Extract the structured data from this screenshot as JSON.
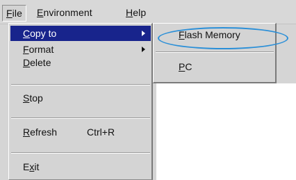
{
  "menubar": {
    "file": {
      "mnemonic": "F",
      "rest": "ile"
    },
    "environment": {
      "mnemonic": "E",
      "rest": "nvironment"
    },
    "help": {
      "mnemonic": "H",
      "rest": "elp"
    }
  },
  "file_menu": {
    "copy_to": {
      "mnemonic": "C",
      "rest": "opy to"
    },
    "format": {
      "mnemonic": "F",
      "rest": "ormat"
    },
    "delete": {
      "mnemonic": "D",
      "rest": "elete"
    },
    "stop": {
      "mnemonic": "S",
      "rest": "top"
    },
    "refresh": {
      "mnemonic": "R",
      "rest": "efresh",
      "shortcut": "Ctrl+R"
    },
    "exit": {
      "pre": "E",
      "mnemonic": "x",
      "rest": "it"
    }
  },
  "copy_to_submenu": {
    "flash_memory": {
      "mnemonic": "F",
      "rest": "lash Memory"
    },
    "pc": {
      "mnemonic": "P",
      "rest": "C"
    }
  },
  "colors": {
    "menu_background": "#d4d4d4",
    "selection": "#18248c",
    "highlight_ring": "#2a8fd8"
  }
}
